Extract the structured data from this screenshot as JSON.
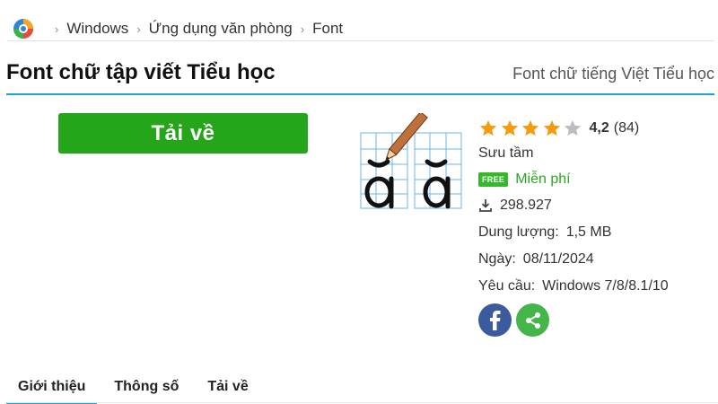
{
  "breadcrumb": {
    "logo_icon": "site-logo-icon",
    "items": [
      "Windows",
      "Ứng dụng văn phòng",
      "Font"
    ]
  },
  "header": {
    "title": "Font chữ tập viết Tiểu học",
    "subtitle": "Font chữ tiếng Việt Tiểu học"
  },
  "download_button": {
    "label": "Tải về",
    "color": "#25a519"
  },
  "app": {
    "icon": "handwriting-font-icon",
    "rating": {
      "value": "4,2",
      "count": "(84)",
      "stars_filled": 4,
      "stars_total": 5
    },
    "source": "Sưu tầm",
    "license_badge": "FREE",
    "license": "Miễn phí",
    "downloads": "298.927",
    "size_label": "Dung lượng:",
    "size_value": "1,5 MB",
    "date_label": "Ngày:",
    "date_value": "08/11/2024",
    "req_label": "Yêu cầu:",
    "req_value": "Windows 7/8/8.1/10"
  },
  "social": {
    "facebook": "facebook-icon",
    "share": "share-icon"
  },
  "tabs": [
    {
      "label": "Giới thiệu",
      "active": true
    },
    {
      "label": "Thông số",
      "active": false
    },
    {
      "label": "Tải về",
      "active": false
    }
  ],
  "colors": {
    "accent": "#1ea3d8",
    "star": "#f39c12",
    "star_empty": "#bdbdbd",
    "free": "#2aa620"
  }
}
